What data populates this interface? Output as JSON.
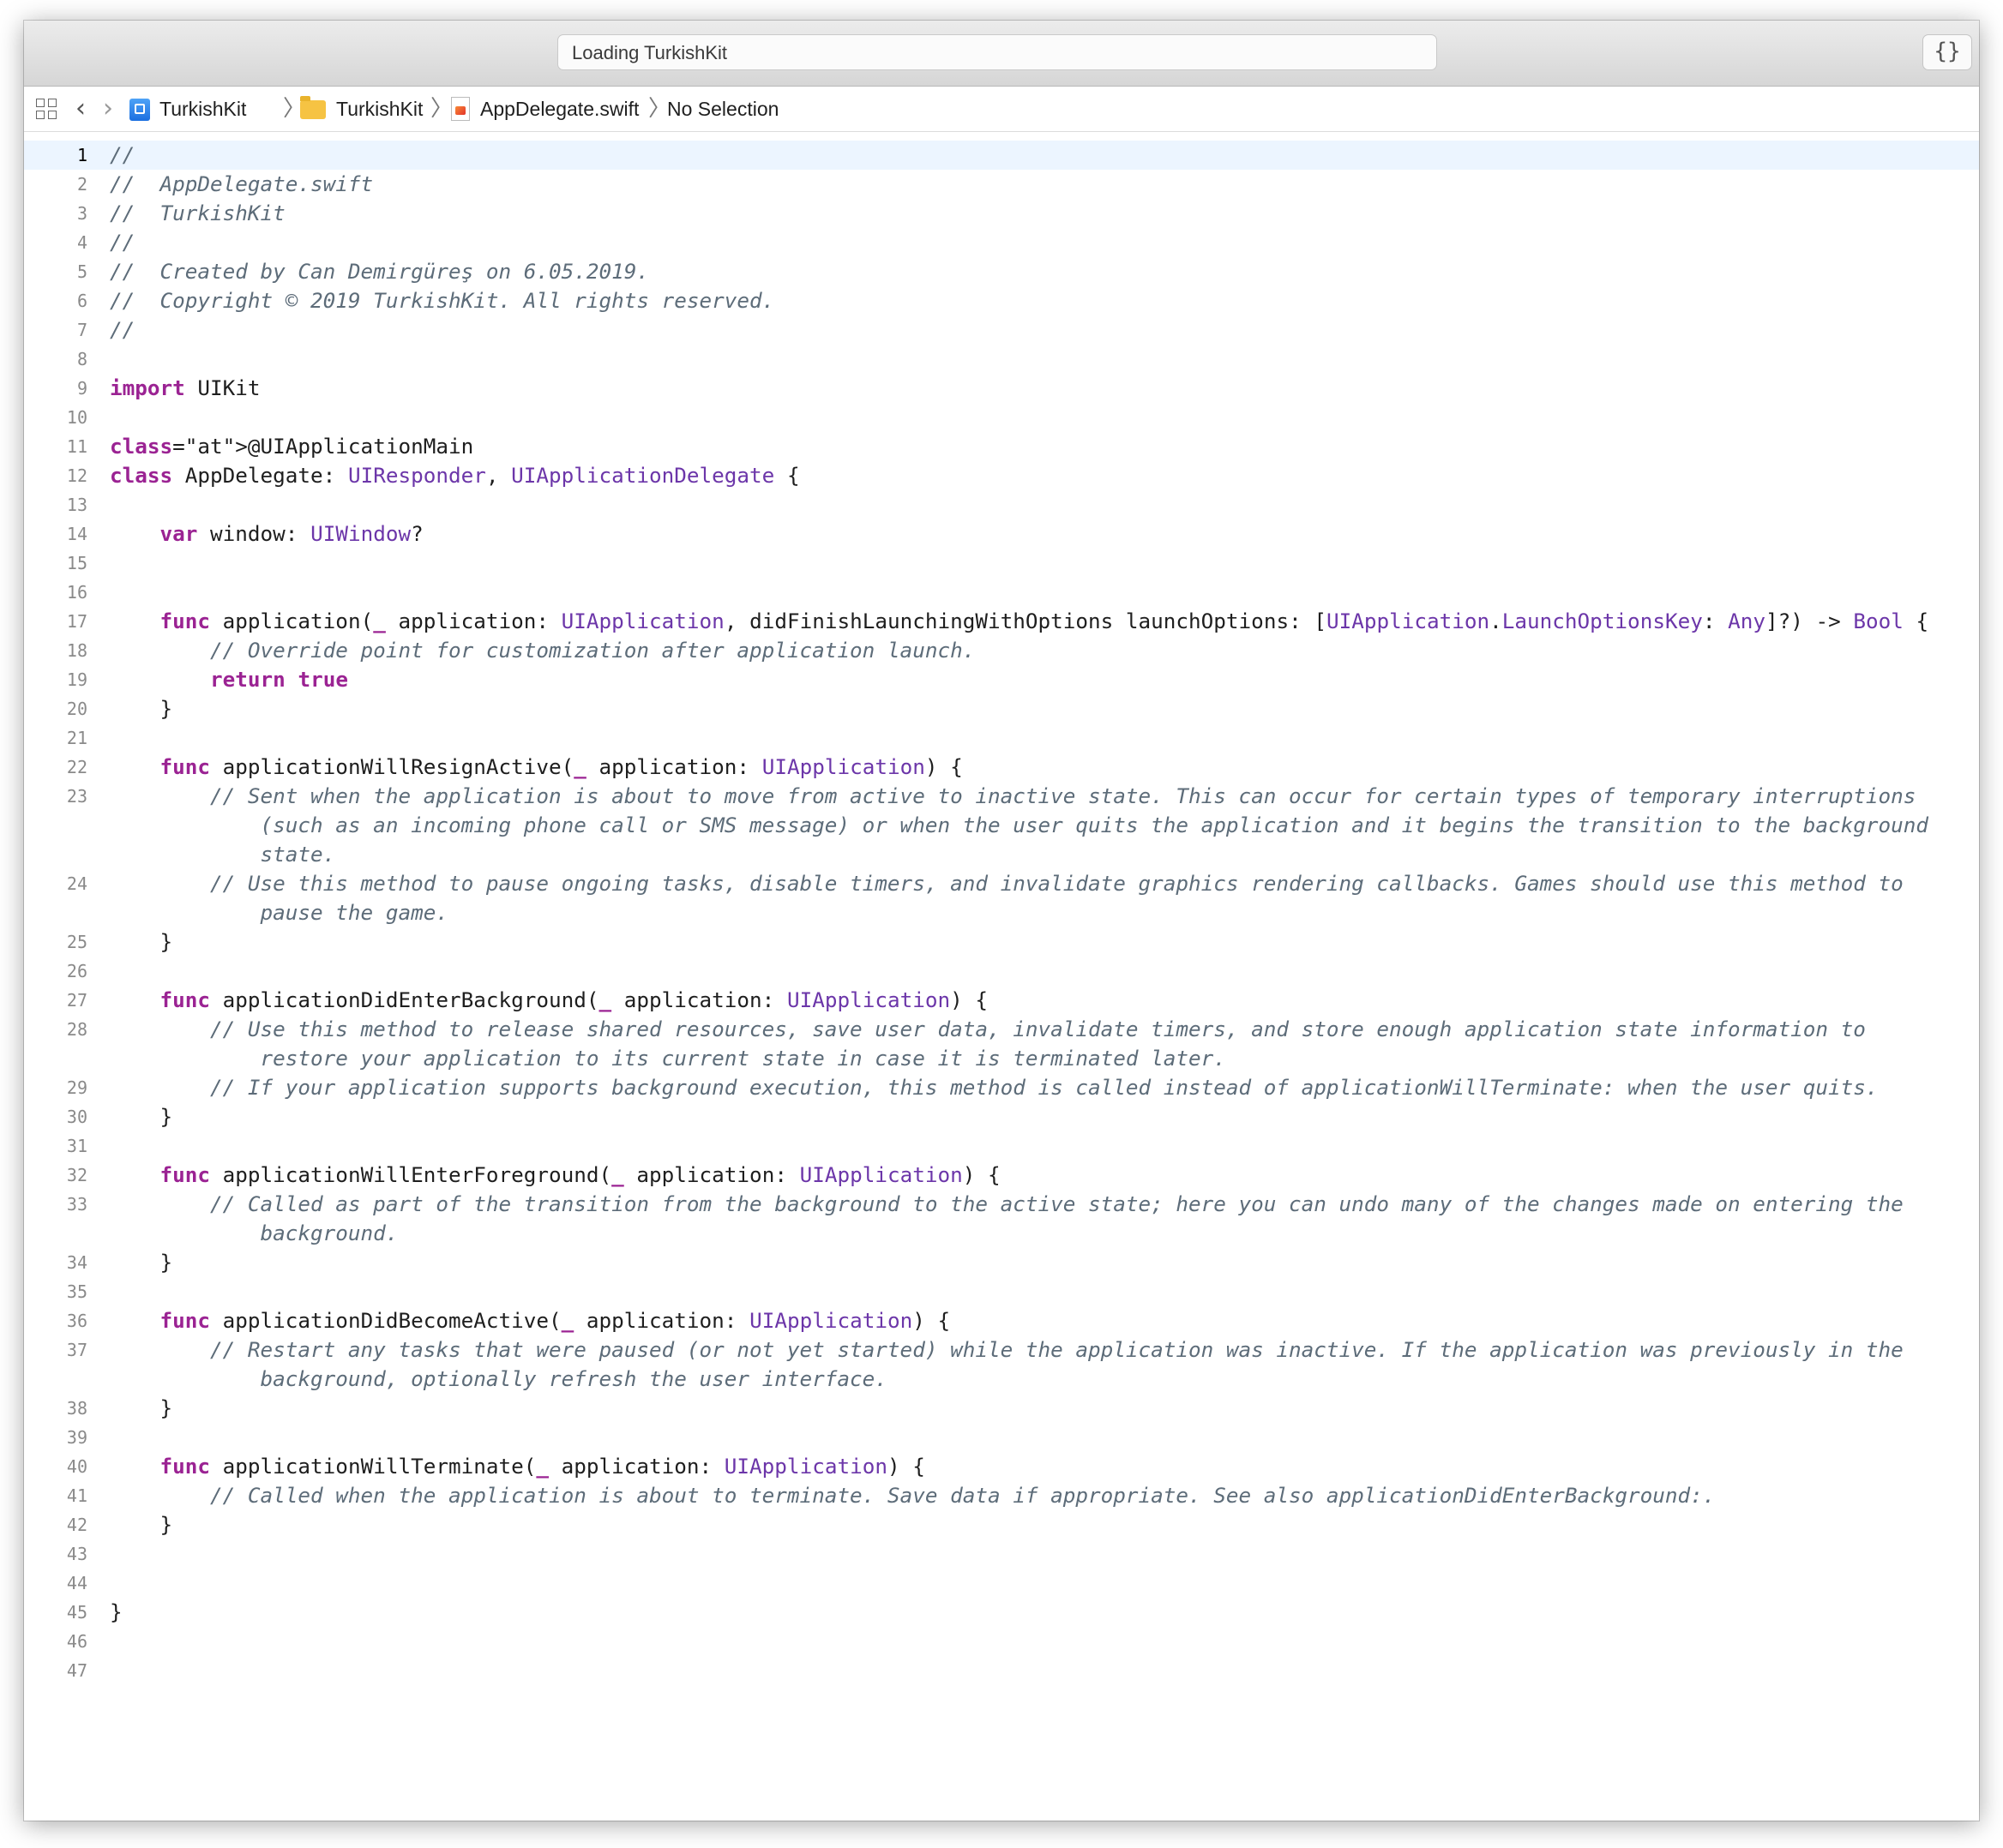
{
  "window": {
    "status": "Loading TurkishKit",
    "code_review_glyph": "{}"
  },
  "jumpbar": {
    "related_items_icon": "grid-icon",
    "back_icon": "chevron-left-icon",
    "forward_icon": "chevron-right-icon",
    "crumbs": [
      {
        "label": "TurkishKit",
        "icon": "xcode-project-icon"
      },
      {
        "label": "TurkishKit",
        "icon": "folder-icon"
      },
      {
        "label": "AppDelegate.swift",
        "icon": "swift-file-icon"
      },
      {
        "label": "No Selection",
        "icon": ""
      }
    ]
  },
  "editor": {
    "current_line": 1,
    "lines": [
      {
        "n": "1",
        "code": "//"
      },
      {
        "n": "2",
        "code": "//  AppDelegate.swift"
      },
      {
        "n": "3",
        "code": "//  TurkishKit"
      },
      {
        "n": "4",
        "code": "//"
      },
      {
        "n": "5",
        "code": "//  Created by Can Demirgüreş on 6.05.2019."
      },
      {
        "n": "6",
        "code": "//  Copyright © 2019 TurkishKit. All rights reserved."
      },
      {
        "n": "7",
        "code": "//"
      },
      {
        "n": "8",
        "code": ""
      },
      {
        "n": "9",
        "code": "import UIKit"
      },
      {
        "n": "10",
        "code": ""
      },
      {
        "n": "11",
        "code": "@UIApplicationMain"
      },
      {
        "n": "12",
        "code": "class AppDelegate: UIResponder, UIApplicationDelegate {"
      },
      {
        "n": "13",
        "code": ""
      },
      {
        "n": "14",
        "code": "    var window: UIWindow?"
      },
      {
        "n": "15",
        "code": ""
      },
      {
        "n": "16",
        "code": ""
      },
      {
        "n": "17",
        "code": "    func application(_ application: UIApplication, didFinishLaunchingWithOptions launchOptions: [UIApplication.LaunchOptionsKey: Any]?) -> Bool {"
      },
      {
        "n": "18",
        "code": "        // Override point for customization after application launch."
      },
      {
        "n": "19",
        "code": "        return true"
      },
      {
        "n": "20",
        "code": "    }"
      },
      {
        "n": "21",
        "code": ""
      },
      {
        "n": "22",
        "code": "    func applicationWillResignActive(_ application: UIApplication) {"
      },
      {
        "n": "23",
        "code": "        // Sent when the application is about to move from active to inactive state. This can occur for certain types of temporary interruptions"
      },
      {
        "n": "",
        "code": "            (such as an incoming phone call or SMS message) or when the user quits the application and it begins the transition to the background"
      },
      {
        "n": "",
        "code": "            state."
      },
      {
        "n": "24",
        "code": "        // Use this method to pause ongoing tasks, disable timers, and invalidate graphics rendering callbacks. Games should use this method to"
      },
      {
        "n": "",
        "code": "            pause the game."
      },
      {
        "n": "25",
        "code": "    }"
      },
      {
        "n": "26",
        "code": ""
      },
      {
        "n": "27",
        "code": "    func applicationDidEnterBackground(_ application: UIApplication) {"
      },
      {
        "n": "28",
        "code": "        // Use this method to release shared resources, save user data, invalidate timers, and store enough application state information to"
      },
      {
        "n": "",
        "code": "            restore your application to its current state in case it is terminated later."
      },
      {
        "n": "29",
        "code": "        // If your application supports background execution, this method is called instead of applicationWillTerminate: when the user quits."
      },
      {
        "n": "30",
        "code": "    }"
      },
      {
        "n": "31",
        "code": ""
      },
      {
        "n": "32",
        "code": "    func applicationWillEnterForeground(_ application: UIApplication) {"
      },
      {
        "n": "33",
        "code": "        // Called as part of the transition from the background to the active state; here you can undo many of the changes made on entering the"
      },
      {
        "n": "",
        "code": "            background."
      },
      {
        "n": "34",
        "code": "    }"
      },
      {
        "n": "35",
        "code": ""
      },
      {
        "n": "36",
        "code": "    func applicationDidBecomeActive(_ application: UIApplication) {"
      },
      {
        "n": "37",
        "code": "        // Restart any tasks that were paused (or not yet started) while the application was inactive. If the application was previously in the"
      },
      {
        "n": "",
        "code": "            background, optionally refresh the user interface."
      },
      {
        "n": "38",
        "code": "    }"
      },
      {
        "n": "39",
        "code": ""
      },
      {
        "n": "40",
        "code": "    func applicationWillTerminate(_ application: UIApplication) {"
      },
      {
        "n": "41",
        "code": "        // Called when the application is about to terminate. Save data if appropriate. See also applicationDidEnterBackground:."
      },
      {
        "n": "42",
        "code": "    }"
      },
      {
        "n": "43",
        "code": ""
      },
      {
        "n": "44",
        "code": ""
      },
      {
        "n": "45",
        "code": "}"
      },
      {
        "n": "46",
        "code": ""
      },
      {
        "n": "47",
        "code": ""
      }
    ]
  },
  "syntax_colors": {
    "comment": "#5d6c79",
    "keyword": "#9b2393",
    "type": "#6c36a9",
    "plain": "#1e1e1e"
  }
}
